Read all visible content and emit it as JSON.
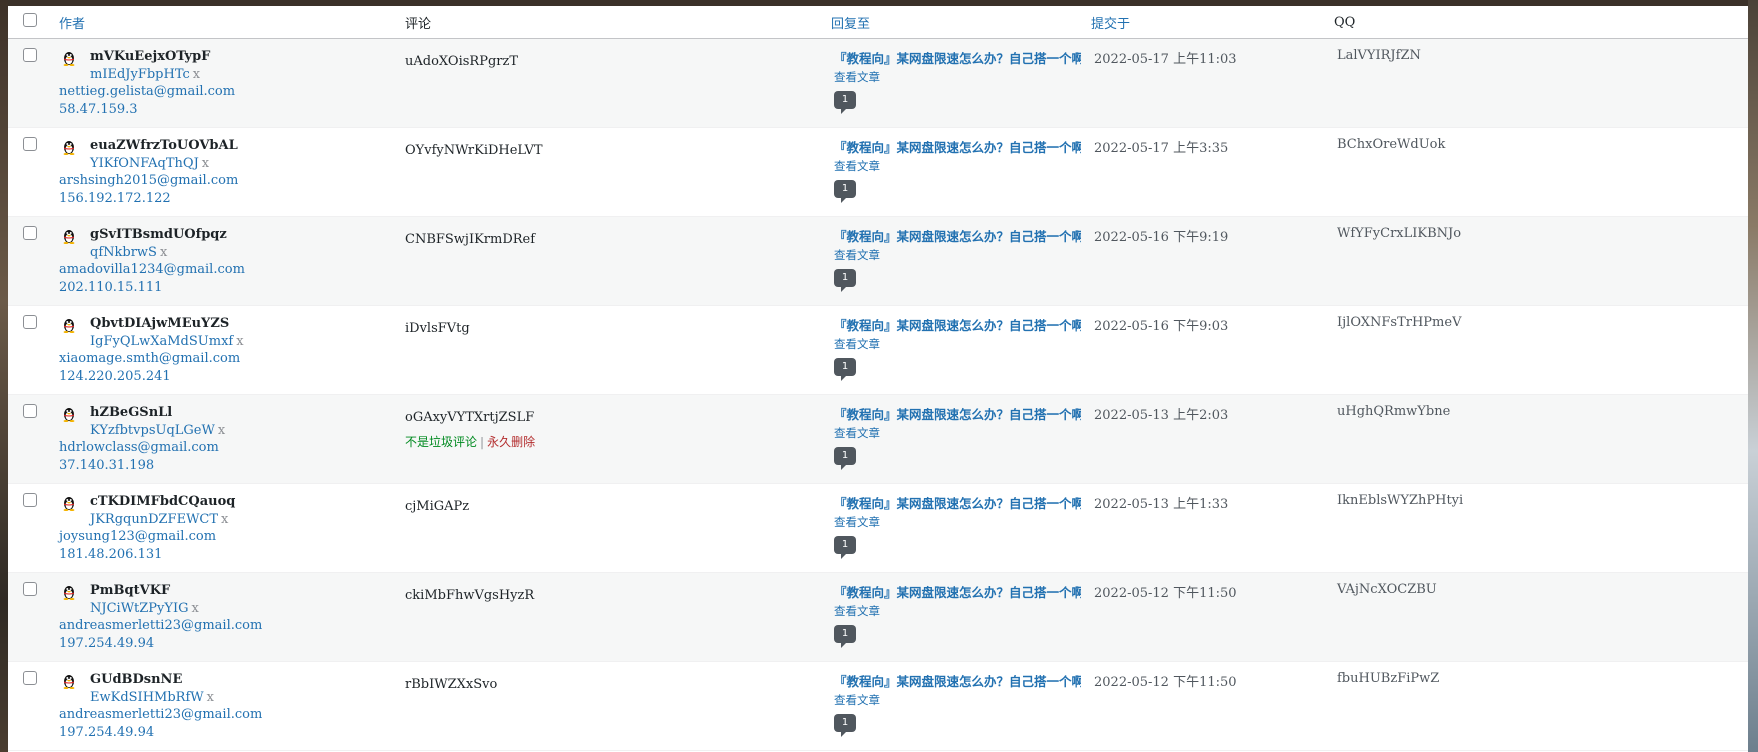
{
  "header": {
    "author": "作者",
    "comment": "评论",
    "in_response_to": "回复至",
    "submitted_on": "提交于",
    "qq": "QQ"
  },
  "rows": [
    {
      "name": "mVKuEejxOTypF",
      "url": "mIEdJyFbpHTc",
      "email": "nettieg.gelista@gmail.com",
      "ip": "58.47.159.3",
      "comment": "uAdoXOisRPgrzT",
      "post_title": "『教程向』某网盘限速怎么办？自己搭一个啊",
      "view_post": "查看文章",
      "count": "1",
      "date": "2022-05-17 上午11:03",
      "qq": "LalVYIRJfZN"
    },
    {
      "name": "euaZWfrzToUOVbAL",
      "url": "YIKfONFAqThQJ",
      "email": "arshsingh2015@gmail.com",
      "ip": "156.192.172.122",
      "comment": "OYvfyNWrKiDHeLVT",
      "post_title": "『教程向』某网盘限速怎么办？自己搭一个啊",
      "view_post": "查看文章",
      "count": "1",
      "date": "2022-05-17 上午3:35",
      "qq": "BChxOreWdUok"
    },
    {
      "name": "gSvITBsmdUOfpqz",
      "url": "qfNkbrwS",
      "email": "amadovilla1234@gmail.com",
      "ip": "202.110.15.111",
      "comment": "CNBFSwjIKrmDRef",
      "post_title": "『教程向』某网盘限速怎么办？自己搭一个啊",
      "view_post": "查看文章",
      "count": "1",
      "date": "2022-05-16 下午9:19",
      "qq": "WfYFyCrxLIKBNJo"
    },
    {
      "name": "QbvtDIAjwMEuYZS",
      "url": "IgFyQLwXaMdSUmxf",
      "email": "xiaomage.smth@gmail.com",
      "ip": "124.220.205.241",
      "comment": "iDvlsFVtg",
      "post_title": "『教程向』某网盘限速怎么办？自己搭一个啊",
      "view_post": "查看文章",
      "count": "1",
      "date": "2022-05-16 下午9:03",
      "qq": "IjlOXNFsTrHPmeV"
    },
    {
      "name": "hZBeGSnLl",
      "url": "KYzfbtvpsUqLGeW",
      "email": "hdrlowclass@gmail.com",
      "ip": "37.140.31.198",
      "comment": "oGAxyVYTXrtjZSLF",
      "not_spam": "不是垃圾评论",
      "delete_permanently": "永久删除",
      "post_title": "『教程向』某网盘限速怎么办？自己搭一个啊",
      "view_post": "查看文章",
      "count": "1",
      "date": "2022-05-13 上午2:03",
      "qq": "uHghQRmwYbne"
    },
    {
      "name": "cTKDIMFbdCQauoq",
      "url": "JKRgqunDZFEWCT",
      "email": "joysung123@gmail.com",
      "ip": "181.48.206.131",
      "comment": "cjMiGAPz",
      "post_title": "『教程向』某网盘限速怎么办？自己搭一个啊",
      "view_post": "查看文章",
      "count": "1",
      "date": "2022-05-13 上午1:33",
      "qq": "IknEblsWYZhPHtyi"
    },
    {
      "name": "PmBqtVKF",
      "url": "NJCiWtZPyYIG",
      "email": "andreasmerletti23@gmail.com",
      "ip": "197.254.49.94",
      "comment": "ckiMbFhwVgsHyzR",
      "post_title": "『教程向』某网盘限速怎么办？自己搭一个啊",
      "view_post": "查看文章",
      "count": "1",
      "date": "2022-05-12 下午11:50",
      "qq": "VAjNcXOCZBU"
    },
    {
      "name": "GUdBDsnNE",
      "url": "EwKdSIHMbRfW",
      "email": "andreasmerletti23@gmail.com",
      "ip": "197.254.49.94",
      "comment": "rBbIWZXxSvo",
      "post_title": "『教程向』某网盘限速怎么办？自己搭一个啊",
      "view_post": "查看文章",
      "count": "1",
      "date": "2022-05-12 下午11:50",
      "qq": "fbuHUBzFiPwZ"
    }
  ],
  "x_mark": "x"
}
